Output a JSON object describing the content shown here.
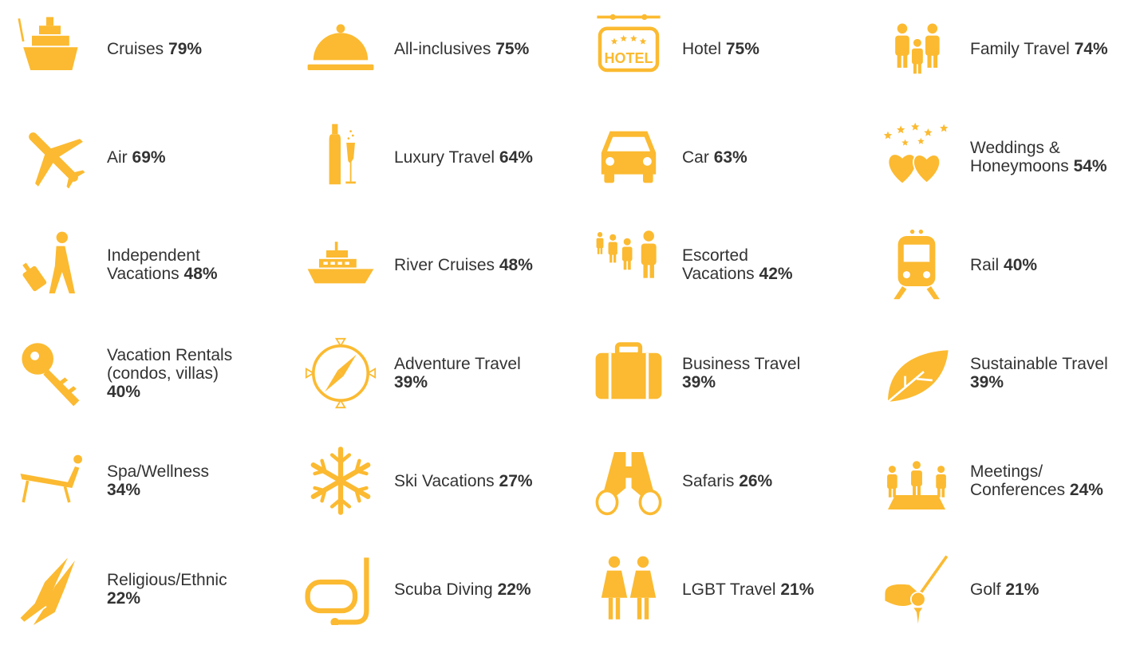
{
  "accent_color": "#FBBA31",
  "text_color": "#333333",
  "categories": [
    {
      "icon": "cruise-ship-icon",
      "lines": [
        "Cruises"
      ],
      "percent": "79%"
    },
    {
      "icon": "serving-dome-icon",
      "lines": [
        "All-inclusives"
      ],
      "percent": "75%"
    },
    {
      "icon": "hotel-sign-icon",
      "icon_text": "HOTEL",
      "lines": [
        "Hotel"
      ],
      "percent": "75%"
    },
    {
      "icon": "family-icon",
      "lines": [
        "Family Travel"
      ],
      "percent": "74%"
    },
    {
      "icon": "airplane-icon",
      "lines": [
        "Air"
      ],
      "percent": "69%"
    },
    {
      "icon": "champagne-icon",
      "lines": [
        "Luxury Travel"
      ],
      "percent": "64%"
    },
    {
      "icon": "car-icon",
      "lines": [
        "Car"
      ],
      "percent": "63%"
    },
    {
      "icon": "hearts-stars-icon",
      "lines": [
        "Weddings &",
        "Honeymoons"
      ],
      "percent": "54%"
    },
    {
      "icon": "traveler-luggage-icon",
      "lines": [
        "Independent",
        "Vacations"
      ],
      "percent": "48%"
    },
    {
      "icon": "yacht-icon",
      "lines": [
        "River Cruises"
      ],
      "percent": "48%"
    },
    {
      "icon": "tour-group-icon",
      "lines": [
        "Escorted",
        "Vacations"
      ],
      "percent": "42%"
    },
    {
      "icon": "train-icon",
      "lines": [
        "Rail"
      ],
      "percent": "40%"
    },
    {
      "icon": "key-icon",
      "lines": [
        "Vacation Rentals",
        "(condos, villas)"
      ],
      "percent": "40%",
      "percent_own_line": true
    },
    {
      "icon": "compass-icon",
      "lines": [
        "Adventure Travel"
      ],
      "percent": "39%",
      "percent_own_line": true
    },
    {
      "icon": "suitcase-icon",
      "lines": [
        "Business Travel"
      ],
      "percent": "39%",
      "percent_own_line": true
    },
    {
      "icon": "leaf-icon",
      "lines": [
        "Sustainable Travel"
      ],
      "percent": "39%",
      "percent_own_line": true
    },
    {
      "icon": "lounge-chair-icon",
      "lines": [
        "Spa/Wellness"
      ],
      "percent": "34%",
      "percent_own_line": true
    },
    {
      "icon": "snowflake-icon",
      "lines": [
        "Ski Vacations"
      ],
      "percent": "27%"
    },
    {
      "icon": "binoculars-icon",
      "lines": [
        "Safaris"
      ],
      "percent": "26%"
    },
    {
      "icon": "meeting-table-icon",
      "lines": [
        "Meetings/",
        "Conferences"
      ],
      "percent": "24%"
    },
    {
      "icon": "praying-hands-icon",
      "lines": [
        "Religious/Ethnic"
      ],
      "percent": "22%",
      "percent_own_line": true
    },
    {
      "icon": "snorkel-mask-icon",
      "lines": [
        "Scuba Diving"
      ],
      "percent": "22%"
    },
    {
      "icon": "couple-icon",
      "lines": [
        "LGBT Travel"
      ],
      "percent": "21%"
    },
    {
      "icon": "golf-icon",
      "lines": [
        "Golf"
      ],
      "percent": "21%"
    }
  ]
}
